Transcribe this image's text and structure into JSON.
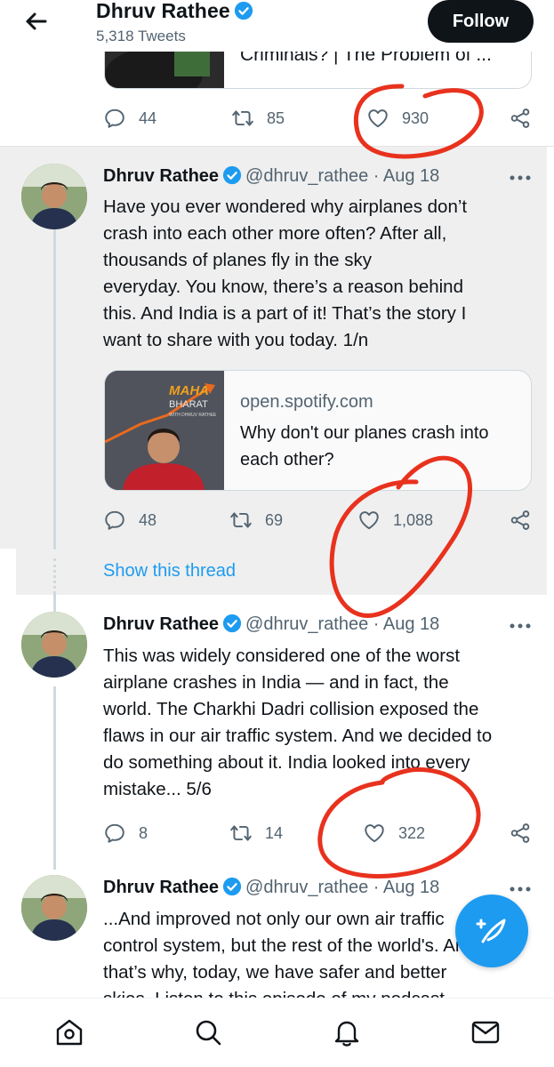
{
  "header": {
    "name": "Dhruv Rathee",
    "tweet_count": "5,318 Tweets",
    "follow_label": "Follow"
  },
  "prev_tweet": {
    "card_title": "Criminals? | The Problem of ...",
    "replies": "44",
    "retweets": "85",
    "likes": "930"
  },
  "tweets": [
    {
      "name": "Dhruv Rathee",
      "handle": "@dhruv_rathee",
      "dot": "·",
      "date": "Aug 18",
      "text_lines": [
        "Have you ever wondered why airplanes don’t",
        "crash into each other more often? After all,",
        "thousands of planes fly in the sky",
        "everyday. You know, there’s a reason behind",
        "this. And India is a part of it! That’s the story I",
        "want to share with you today. 1/n"
      ],
      "card": {
        "domain": "open.spotify.com",
        "title": "Why don't our planes crash into each other?",
        "img_logo": "MAHA",
        "img_logo2": "BHARAT",
        "img_sub": "WITH DHRUV RATHEE"
      },
      "replies": "48",
      "retweets": "69",
      "likes": "1,088",
      "show_thread": "Show this thread"
    },
    {
      "name": "Dhruv Rathee",
      "handle": "@dhruv_rathee",
      "dot": "·",
      "date": "Aug 18",
      "text_lines": [
        "This was widely considered one of the worst",
        "airplane crashes in India — and in fact, the",
        "world. The Charkhi Dadri collision exposed the",
        "flaws in our air traffic system. And we decided to",
        "do something about it. India looked into every",
        "mistake... 5/6"
      ],
      "replies": "8",
      "retweets": "14",
      "likes": "322"
    },
    {
      "name": "Dhruv Rathee",
      "handle": "@dhruv_rathee",
      "dot": "·",
      "date": "Aug 18",
      "text_lines": [
        "...And improved not only our own air traffic",
        "control system, but the rest of the world's. And",
        "that’s why, today, we have safer and better",
        "skies. Listen to this episode of my podcast"
      ]
    }
  ],
  "nav": {
    "items": [
      "home-icon",
      "search-icon",
      "notifications-icon",
      "messages-icon"
    ]
  },
  "colors": {
    "accent": "#1d9bf0",
    "annotation": "#e8321e",
    "highlight_bg": "#efefef"
  }
}
